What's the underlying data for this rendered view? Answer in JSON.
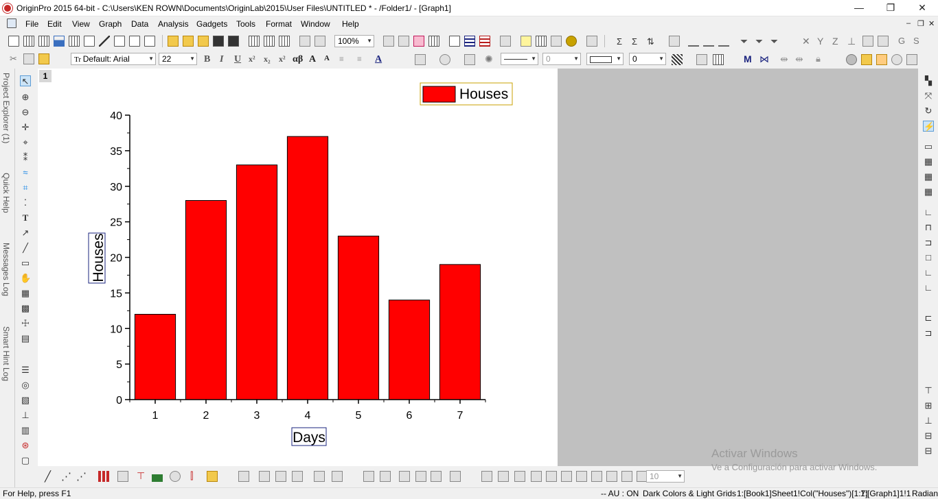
{
  "window": {
    "title": "OriginPro 2015 64-bit - C:\\Users\\KEN ROWN\\Documents\\OriginLab\\2015\\User Files\\UNTITLED * - /Folder1/ - [Graph1]",
    "controls": [
      "—",
      "❐",
      "✕"
    ]
  },
  "menu": [
    {
      "label": "File"
    },
    {
      "label": "Edit"
    },
    {
      "label": "View"
    },
    {
      "label": "Graph"
    },
    {
      "label": "Data"
    },
    {
      "label": "Analysis"
    },
    {
      "label": "Gadgets"
    },
    {
      "label": "Tools"
    },
    {
      "label": "Format"
    },
    {
      "label": "Window"
    },
    {
      "label": "Help"
    }
  ],
  "toolbar": {
    "zoom": "100%",
    "font": "Default: Arial",
    "font_size": "22",
    "line_width": "0",
    "fill_value": "0",
    "bottom_value": "10"
  },
  "dock_tabs": [
    "Project Explorer (1)",
    "Quick Help",
    "Messages Log",
    "Smart Hint Log"
  ],
  "graph": {
    "layer": "1",
    "legend_label": "Houses",
    "bar_color": "#ff0000"
  },
  "chart_data": {
    "type": "bar",
    "categories": [
      "1",
      "2",
      "3",
      "4",
      "5",
      "6",
      "7"
    ],
    "series": [
      {
        "name": "Houses",
        "values": [
          12,
          28,
          33,
          37,
          23,
          14,
          19
        ]
      }
    ],
    "xlabel": "Days",
    "ylabel": "Houses",
    "ylim": [
      0,
      40
    ],
    "yticks": [
      0,
      5,
      10,
      15,
      20,
      25,
      30,
      35,
      40
    ],
    "grid": false,
    "legend": "top-right"
  },
  "status": {
    "help": "For Help, press F1",
    "mode": "-- AU : ON",
    "theme": "Dark Colors & Light Grids",
    "col": "1:[Book1]Sheet1!Col(\"Houses\")[1:7]",
    "graph": "1:[Graph1]1!1",
    "angle": "Radian"
  },
  "watermark": {
    "line1": "Activar Windows",
    "line2": "Ve a Configuración para activar Windows."
  }
}
